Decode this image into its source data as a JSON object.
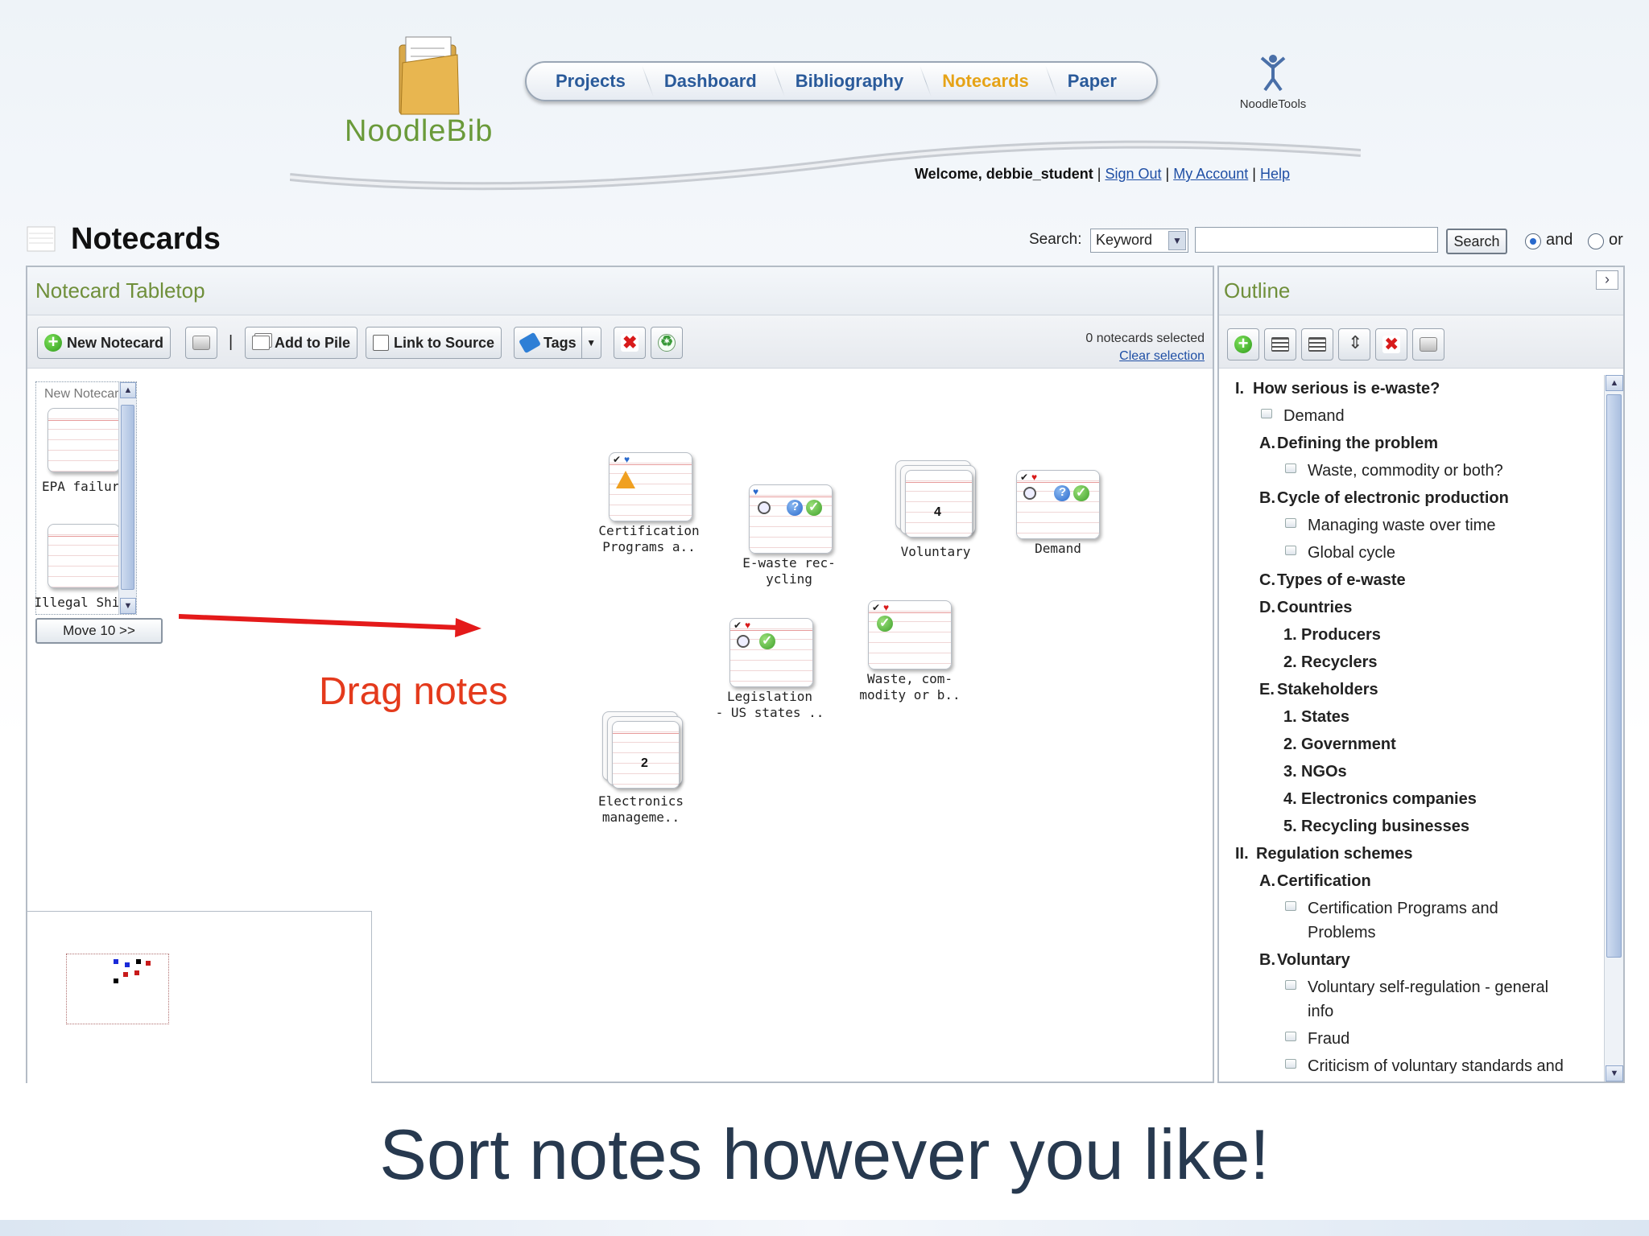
{
  "header": {
    "logo_text": "NoodleBib",
    "tools_logo_text": "NoodleTools",
    "nav": [
      {
        "label": "Projects",
        "active": false
      },
      {
        "label": "Dashboard",
        "active": false
      },
      {
        "label": "Bibliography",
        "active": false
      },
      {
        "label": "Notecards",
        "active": true
      },
      {
        "label": "Paper",
        "active": false
      }
    ],
    "welcome_prefix": "Welcome,",
    "username": "debbie_student",
    "sign_out": "Sign Out",
    "my_account": "My Account",
    "help": "Help",
    "separator": "|"
  },
  "page": {
    "title": "Notecards"
  },
  "search": {
    "label": "Search:",
    "type_value": "Keyword",
    "input_value": "",
    "button": "Search",
    "radio_and": "and",
    "radio_or": "or",
    "selected": "and"
  },
  "tabletop": {
    "title": "Notecard Tabletop",
    "toolbar": {
      "new_notecard": "New Notecard",
      "add_to_pile": "Add to Pile",
      "link_to_source": "Link to Source",
      "tags": "Tags",
      "divider": "|"
    },
    "selected_count": "0 notecards selected",
    "clear_selection": "Clear selection",
    "rail": {
      "label": "New Notecard",
      "cards": [
        "EPA failure",
        "Illegal Ship-"
      ],
      "move_button": "Move 10 >>"
    },
    "cards": [
      {
        "label1": "Certification",
        "label2": "Programs a.."
      },
      {
        "label1": "E-waste rec-",
        "label2": "ycling"
      },
      {
        "label1": "Voluntary",
        "label2": "",
        "count": "4"
      },
      {
        "label1": "Demand",
        "label2": ""
      },
      {
        "label1": "Legislation",
        "label2": "- US states .."
      },
      {
        "label1": "Waste, com-",
        "label2": "modity or b.."
      },
      {
        "label1": "Electronics",
        "label2": "manageme..",
        "count": "2"
      }
    ],
    "annotation": "Drag notes"
  },
  "outline": {
    "title": "Outline",
    "items": [
      {
        "num": "I.",
        "text": "How serious is e-waste?",
        "type": "heading"
      },
      {
        "num": "",
        "text": "Demand",
        "type": "note"
      },
      {
        "num": "A.",
        "text": "Defining the problem",
        "type": "heading"
      },
      {
        "num": "",
        "text": "Waste, commodity or both?",
        "type": "note"
      },
      {
        "num": "B.",
        "text": "Cycle of electronic production",
        "type": "heading"
      },
      {
        "num": "",
        "text": "Managing waste over time",
        "type": "note"
      },
      {
        "num": "",
        "text": "Global cycle",
        "type": "note"
      },
      {
        "num": "C.",
        "text": "Types of e-waste",
        "type": "heading"
      },
      {
        "num": "D.",
        "text": "Countries",
        "type": "heading"
      },
      {
        "num": "1.",
        "text": "Producers",
        "type": "heading"
      },
      {
        "num": "2.",
        "text": "Recyclers",
        "type": "heading"
      },
      {
        "num": "E.",
        "text": "Stakeholders",
        "type": "heading"
      },
      {
        "num": "1.",
        "text": "States",
        "type": "heading"
      },
      {
        "num": "2.",
        "text": "Government",
        "type": "heading"
      },
      {
        "num": "3.",
        "text": "NGOs",
        "type": "heading"
      },
      {
        "num": "4.",
        "text": "Electronics companies",
        "type": "heading"
      },
      {
        "num": "5.",
        "text": "Recycling businesses",
        "type": "heading"
      },
      {
        "num": "II.",
        "text": "Regulation schemes",
        "type": "heading"
      },
      {
        "num": "A.",
        "text": "Certification",
        "type": "heading"
      },
      {
        "num": "",
        "text": "Certification Programs and",
        "text2": "Problems",
        "type": "note"
      },
      {
        "num": "B.",
        "text": "Voluntary",
        "type": "heading"
      },
      {
        "num": "",
        "text": "Voluntary self-regulation - general",
        "text2": "info",
        "type": "note"
      },
      {
        "num": "",
        "text": "Fraud",
        "type": "note"
      },
      {
        "num": "",
        "text": "Criticism of voluntary standards and",
        "type": "note"
      }
    ]
  },
  "caption": "Sort notes however you like!",
  "colors": {
    "nav_text": "#2a5a9a",
    "nav_active": "#e6a317",
    "panel_title": "#6f8f3a",
    "annotation": "#e43a1c",
    "link": "#1f4fa5"
  }
}
